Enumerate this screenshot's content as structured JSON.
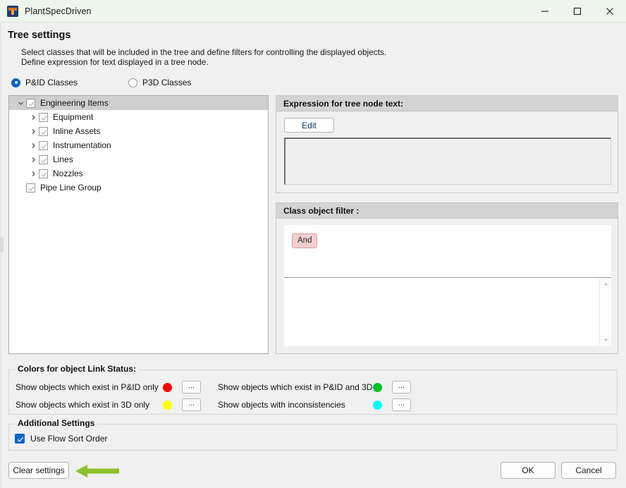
{
  "window": {
    "title": "PlantSpecDriven",
    "icon": "app-icon",
    "controls": {
      "minimize": "minimize-icon",
      "maximize": "maximize-icon",
      "close": "close-icon"
    },
    "titlebar_color": "#eef5ec"
  },
  "header": {
    "title": "Tree settings",
    "description_line_1": "Select classes that will be included in the tree and define filters for controlling the displayed objects.",
    "description_line_2": "Define expression for text displayed in a tree node."
  },
  "class_mode": {
    "options": [
      {
        "label": "P&ID Classes",
        "selected": true
      },
      {
        "label": "P3D Classes",
        "selected": false
      }
    ]
  },
  "tree": {
    "rows": [
      {
        "label": "Engineering Items",
        "level": 0,
        "expanded": true,
        "has_children": true,
        "checked": true,
        "selected": true
      },
      {
        "label": "Equipment",
        "level": 1,
        "expanded": false,
        "has_children": true,
        "checked": true,
        "selected": false
      },
      {
        "label": "Inline Assets",
        "level": 1,
        "expanded": false,
        "has_children": true,
        "checked": true,
        "selected": false
      },
      {
        "label": "Instrumentation",
        "level": 1,
        "expanded": false,
        "has_children": true,
        "checked": true,
        "selected": false
      },
      {
        "label": "Lines",
        "level": 1,
        "expanded": false,
        "has_children": true,
        "checked": true,
        "selected": false
      },
      {
        "label": "Nozzles",
        "level": 1,
        "expanded": false,
        "has_children": true,
        "checked": true,
        "selected": false
      },
      {
        "label": "Pipe Line Group",
        "level": 1,
        "expanded": false,
        "has_children": false,
        "checked": true,
        "selected": false
      }
    ]
  },
  "expression_group": {
    "title": "Expression for tree node text:",
    "edit_button": "Edit",
    "textarea_value": ""
  },
  "filter_group": {
    "title": "Class object filter :",
    "and_badge": "And",
    "list_value": "",
    "scroll_up": "scroll-up-icon",
    "scroll_down": "scroll-down-icon"
  },
  "colors_group": {
    "title": "Colors for object Link Status:",
    "rows": [
      {
        "label": "Show objects which exist in P&ID only",
        "color": "#ff0000",
        "button": "..."
      },
      {
        "label": "Show objects which exist in 3D only",
        "color": "#ffff00",
        "button": "..."
      },
      {
        "label": "Show objects which exist in P&ID and 3D",
        "color": "#00c426",
        "button": "..."
      },
      {
        "label": "Show objects with inconsistencies",
        "color": "#00ffff",
        "button": "..."
      }
    ]
  },
  "additional_settings": {
    "title": "Additional Settings",
    "flow_sort": {
      "label": "Use Flow Sort Order",
      "checked": true
    }
  },
  "footer": {
    "clear_settings": "Clear settings",
    "ok": "OK",
    "cancel": "Cancel"
  },
  "annotation": {
    "arrow": "left-arrow-annotation",
    "color": "#8cc028"
  }
}
